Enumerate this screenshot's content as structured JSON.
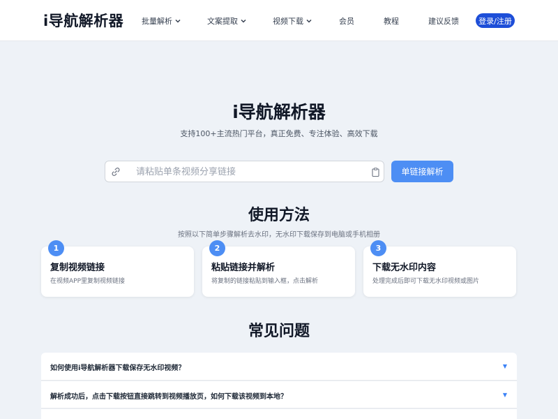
{
  "header": {
    "logo": "i导航解析器",
    "nav": [
      {
        "label": "批量解析",
        "has_dropdown": true
      },
      {
        "label": "文案提取",
        "has_dropdown": true
      },
      {
        "label": "视频下载",
        "has_dropdown": true
      },
      {
        "label": "会员",
        "has_dropdown": false
      },
      {
        "label": "教程",
        "has_dropdown": false
      },
      {
        "label": "建议反馈",
        "has_dropdown": false
      }
    ],
    "login_label": "登录/注册"
  },
  "hero": {
    "title": "i导航解析器",
    "subtitle": "支持100+主流热门平台，真正免费、专注体验、高效下载",
    "search_placeholder": "请粘贴单条视频分享链接",
    "search_value": "",
    "parse_button": "单链接解析"
  },
  "howto": {
    "title": "使用方法",
    "subtitle": "按照以下简单步骤解析去水印，无水印下载保存到电脑或手机相册",
    "steps": [
      {
        "num": "1",
        "title": "复制视频链接",
        "desc": "在视频APP里复制视频链接"
      },
      {
        "num": "2",
        "title": "粘贴链接并解析",
        "desc": "将复制的链接粘贴到输入框，点击解析"
      },
      {
        "num": "3",
        "title": "下载无水印内容",
        "desc": "处理完成后即可下载无水印视频或图片"
      }
    ]
  },
  "faq": {
    "title": "常见问题",
    "items": [
      {
        "question": "如何使用i导航解析器下载保存无水印视频？"
      },
      {
        "question": "解析成功后，点击下载按钮直接跳转到视频播放页，如何下载该视频到本地？"
      },
      {
        "question": ""
      }
    ]
  },
  "colors": {
    "accent": "#4d8ef4",
    "login": "#1d4ed8",
    "background": "#eef2f7"
  }
}
